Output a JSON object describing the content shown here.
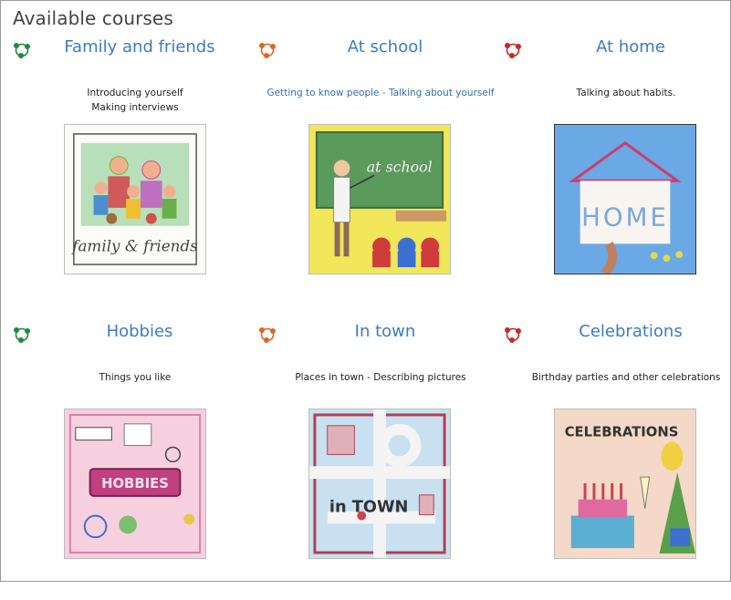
{
  "page": {
    "title": "Available courses"
  },
  "colors": {
    "green": "#1f8a3a",
    "orange": "#e0642a",
    "red": "#c62828",
    "title_blue": "#3a7cc4",
    "link_blue": "#2f6fb5"
  },
  "courses": [
    {
      "title": "Family and friends",
      "icon": "course-logo-green-icon",
      "desc": [
        "Introducing yourself",
        "Making interviews"
      ],
      "image_text": "family & friends"
    },
    {
      "title": "At school",
      "icon": "course-logo-orange-icon",
      "desc": [
        "Getting to know people - Talking about yourself"
      ],
      "image_text": "at school"
    },
    {
      "title": "At home",
      "icon": "course-logo-red-icon",
      "desc": [
        "Talking about habits."
      ],
      "image_text": "HOME"
    },
    {
      "title": "Hobbies",
      "icon": "course-logo-green-icon",
      "desc": [
        "Things you like"
      ],
      "image_text": "HOBBIES"
    },
    {
      "title": "In town",
      "icon": "course-logo-orange-icon",
      "desc": [
        "Places in town - Describing pictures"
      ],
      "image_text": "in TOWN"
    },
    {
      "title": "Celebrations",
      "icon": "course-logo-red-icon",
      "desc": [
        "Birthday parties and other celebrations"
      ],
      "image_text": "CELEBRATIONS"
    }
  ]
}
